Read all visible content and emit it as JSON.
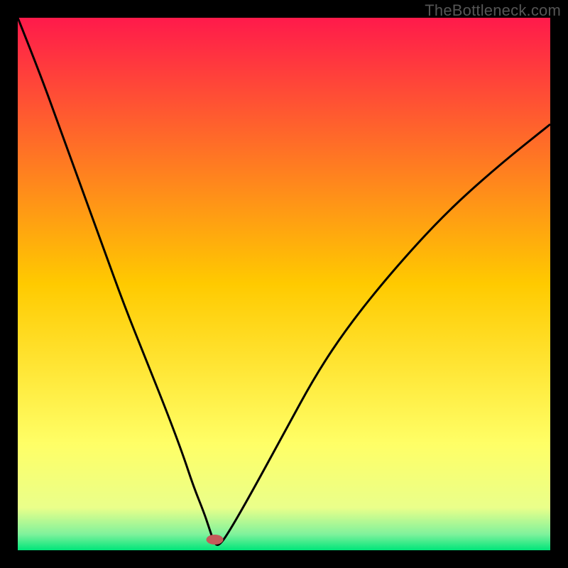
{
  "watermark": "TheBottleneck.com",
  "chart_data": {
    "type": "line",
    "title": "",
    "xlabel": "",
    "ylabel": "",
    "xlim": [
      0,
      100
    ],
    "ylim": [
      0,
      100
    ],
    "background_gradient": {
      "stops": [
        {
          "offset": 0.0,
          "color": "#ff1a4b"
        },
        {
          "offset": 0.5,
          "color": "#ffca00"
        },
        {
          "offset": 0.8,
          "color": "#ffff66"
        },
        {
          "offset": 0.92,
          "color": "#eaff8a"
        },
        {
          "offset": 0.97,
          "color": "#7ff29c"
        },
        {
          "offset": 1.0,
          "color": "#00e57a"
        }
      ]
    },
    "marker": {
      "x": 37,
      "y": 2,
      "color": "#c45a5a",
      "rx": 12,
      "ry": 7
    },
    "series": [
      {
        "name": "bottleneck-curve",
        "x": [
          0,
          4,
          8,
          12,
          16,
          20,
          24,
          28,
          31,
          33,
          35,
          36,
          37,
          38,
          40,
          44,
          50,
          56,
          62,
          70,
          80,
          90,
          100
        ],
        "values": [
          100,
          90,
          79,
          68,
          57,
          46,
          36,
          26,
          18,
          12,
          7,
          4,
          1,
          1,
          4,
          11,
          22,
          33,
          42,
          52,
          63,
          72,
          80
        ]
      }
    ]
  }
}
